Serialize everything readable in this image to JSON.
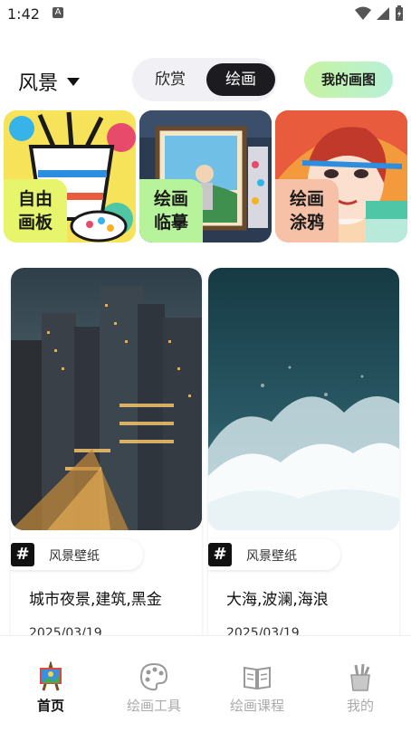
{
  "status": {
    "time": "1:42",
    "notification_letter": "A"
  },
  "header": {
    "category": "风景",
    "segment": {
      "left": "欣赏",
      "right": "绘画"
    },
    "my_button": "我的画图"
  },
  "tiles": [
    {
      "label_line1": "自由",
      "label_line2": "画板"
    },
    {
      "label_line1": "绘画",
      "label_line2": "临摹"
    },
    {
      "label_line1": "绘画",
      "label_line2": "涂鸦"
    }
  ],
  "cards": [
    {
      "tag": "风景壁纸",
      "title": "城市夜景,建筑,黑金",
      "date": "2025/03/19"
    },
    {
      "tag": "风景壁纸",
      "title": "大海,波澜,海浪",
      "date": "2025/03/19"
    }
  ],
  "tabbar": [
    {
      "label": "首页"
    },
    {
      "label": "绘画工具"
    },
    {
      "label": "绘画课程"
    },
    {
      "label": "我的"
    }
  ],
  "colors": {
    "accent_dark": "#1c1c20",
    "my_button_gradient": [
      "#c6f3a0",
      "#b8f0d8"
    ],
    "tile1_label": "#e6f56b",
    "tile2_label": "#b6f39a",
    "tile3_label": "#f7c1a8"
  }
}
